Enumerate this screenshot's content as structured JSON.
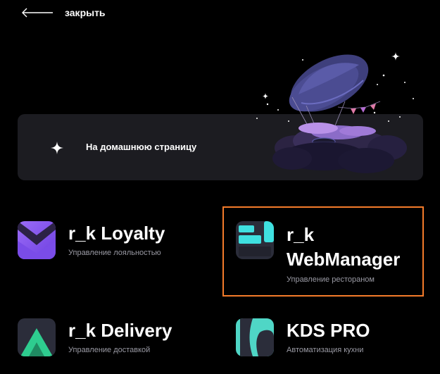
{
  "header": {
    "close_label": "закрыть",
    "close_icon": "arrow-left-icon"
  },
  "hero": {
    "label": "На домашнюю страницу",
    "icon": "sparkle-icon"
  },
  "apps": [
    {
      "title": "r_k Loyalty",
      "subtitle": "Управление лояльностью",
      "icon": "loyalty-icon",
      "selected": false
    },
    {
      "title": "r_k WebManager",
      "subtitle": "Управление рестораном",
      "icon": "webmanager-icon",
      "selected": true
    },
    {
      "title": "r_k Delivery",
      "subtitle": "Управление доставкой",
      "icon": "delivery-icon",
      "selected": false
    },
    {
      "title": "KDS PRO",
      "subtitle": "Автоматизация кухни",
      "icon": "kds-icon",
      "selected": false
    }
  ],
  "colors": {
    "background": "#000000",
    "card": "#1c1c21",
    "selection_border": "#f47b2a",
    "loyalty": "#8a5cf6",
    "webmanager": "#3fe0e0",
    "delivery": "#2ecc8f",
    "kds": "#4fd6c6"
  }
}
